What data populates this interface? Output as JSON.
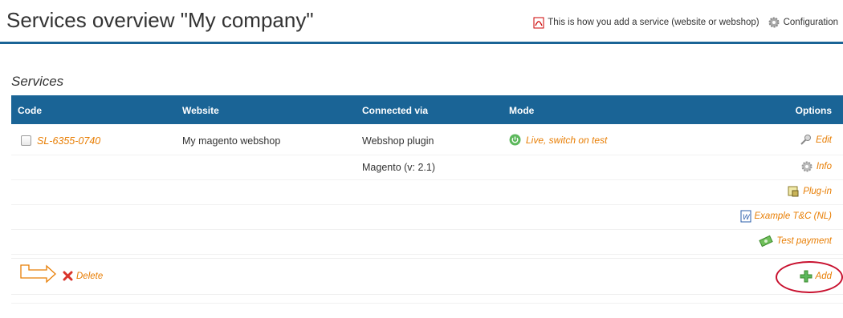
{
  "header": {
    "title": "Services overview \"My company\"",
    "help_link": "This is how you add a service (website or webshop)",
    "config_link": "Configuration"
  },
  "section": {
    "title": "Services"
  },
  "table": {
    "columns": [
      "Code",
      "Website",
      "Connected via",
      "Mode",
      "Options"
    ],
    "row": {
      "code": "SL-6355-0740",
      "website": "My magento webshop",
      "connected_via": "Webshop plugin",
      "connected_version": "Magento (v: 2.1)",
      "mode": "Live, switch on test"
    },
    "options": [
      "Edit",
      "Info",
      "Plug-in",
      "Example T&C (NL)",
      "Test payment"
    ]
  },
  "footer": {
    "delete_label": "Delete",
    "add_label": "Add"
  },
  "colors": {
    "header_blue": "#1a6496",
    "link_orange": "#e87e04",
    "highlight_red": "#c8102e",
    "live_green": "#5cb85c"
  },
  "icons": [
    "pdf-icon",
    "gear-icon",
    "power-icon",
    "key-icon",
    "plugin-icon",
    "word-doc-icon",
    "money-icon",
    "arrow-icon",
    "delete-x-icon",
    "plus-icon"
  ]
}
